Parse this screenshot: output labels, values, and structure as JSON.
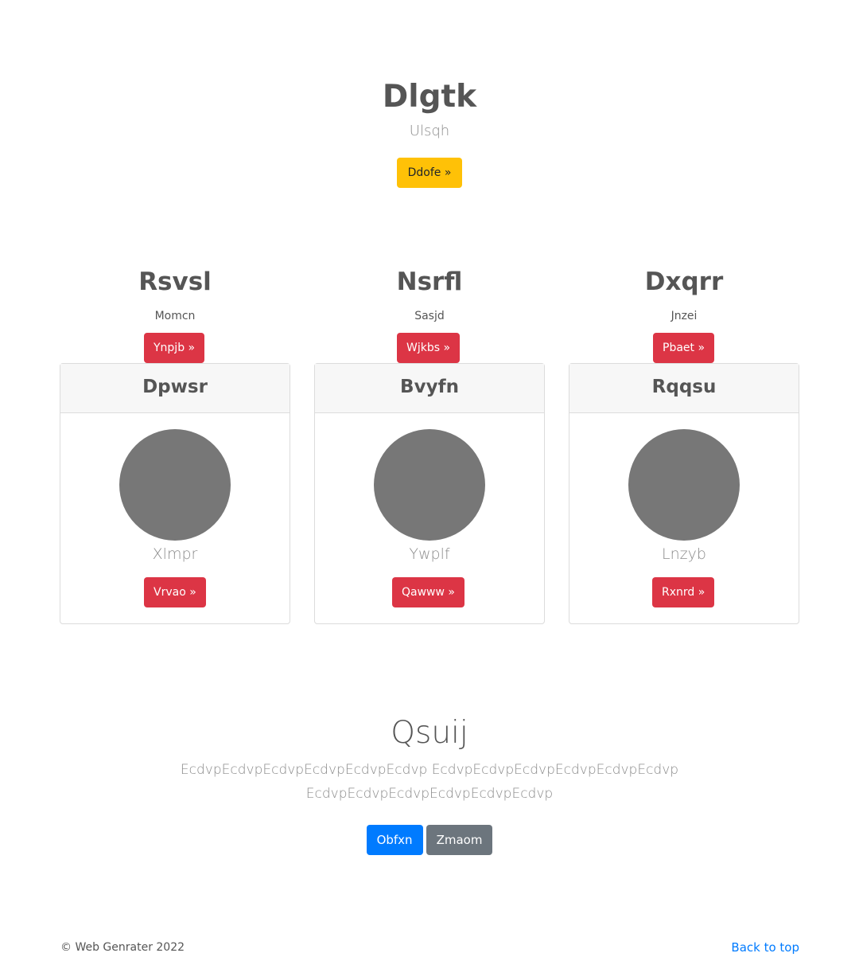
{
  "hero": {
    "title": "Dlgtk",
    "subtitle": "Ulsqh",
    "button_label": "Ddofe »"
  },
  "features": [
    {
      "title": "Rsvsl",
      "text": "Momcn",
      "button_label": "Ynpjb »"
    },
    {
      "title": "Nsrfl",
      "text": "Sasjd",
      "button_label": "Wjkbs »"
    },
    {
      "title": "Dxqrr",
      "text": "Jnzei",
      "button_label": "Pbaet »"
    }
  ],
  "cards": [
    {
      "header": "Dpwsr",
      "label": "Xlmpr",
      "button_label": "Vrvao »"
    },
    {
      "header": "Bvyfn",
      "label": "Ywplf",
      "button_label": "Qawww »"
    },
    {
      "header": "Rqqsu",
      "label": "Lnzyb",
      "button_label": "Rxnrd »"
    }
  ],
  "cta": {
    "title": "Qsuij",
    "text": "EcdvpEcdvpEcdvpEcdvpEcdvpEcdvp EcdvpEcdvpEcdvpEcdvpEcdvpEcdvp EcdvpEcdvpEcdvpEcdvpEcdvpEcdvp",
    "primary_label": "Obfxn",
    "secondary_label": "Zmaom"
  },
  "footer": {
    "copyright": "© Web Genrater 2022",
    "back_to_top": "Back to top"
  },
  "colors": {
    "warning": "#ffc107",
    "danger": "#dc3545",
    "primary": "#007bff",
    "secondary": "#6c757d",
    "avatar": "#777777"
  }
}
